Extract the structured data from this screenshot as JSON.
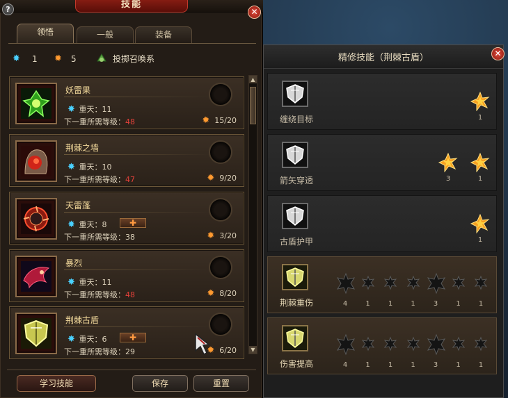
{
  "window": {
    "title": "技能",
    "help": "?",
    "close": "✕"
  },
  "tabs": [
    {
      "label": "领悟",
      "active": true
    },
    {
      "label": "一般",
      "active": false
    },
    {
      "label": "装备",
      "active": false
    }
  ],
  "stats": {
    "blue_points": "1",
    "orange_points": "5",
    "school": "投掷召唤系"
  },
  "skills": [
    {
      "name": "妖雷果",
      "level": "重天：11",
      "req_label": "下一重所需等级：",
      "req_value": "48",
      "req_met": false,
      "progress": "15/20",
      "has_plus": false,
      "icon": "thorn-fruit-icon",
      "color": "#2a7a18"
    },
    {
      "name": "荆棘之墙",
      "level": "重天：10",
      "req_label": "下一重所需等级：",
      "req_value": "47",
      "req_met": false,
      "progress": "9/20",
      "has_plus": false,
      "icon": "thorn-wall-icon",
      "color": "#c0241a"
    },
    {
      "name": "天雷蓬",
      "level": "重天：8",
      "req_label": "下一重所需等级：",
      "req_value": "38",
      "req_met": true,
      "progress": "3/20",
      "has_plus": true,
      "icon": "thunder-pod-icon",
      "color": "#d0301a"
    },
    {
      "name": "暴烈",
      "level": "重天：11",
      "req_label": "下一重所需等级：",
      "req_value": "48",
      "req_met": false,
      "progress": "8/20",
      "has_plus": false,
      "icon": "fury-icon",
      "color": "#b01a3a"
    },
    {
      "name": "荆棘古盾",
      "level": "重天：6",
      "req_label": "下一重所需等级：",
      "req_value": "29",
      "req_met": true,
      "progress": "6/20",
      "has_plus": true,
      "icon": "thorn-shield-icon",
      "color": "#c0c040"
    }
  ],
  "buttons": {
    "learn": "学习技能",
    "save": "保存",
    "reset": "重置"
  },
  "refine": {
    "title": "精修技能（荆棘古盾）",
    "close": "✕",
    "rows": [
      {
        "label": "缠绕目标",
        "style": "dark",
        "stars": [
          {
            "value": "1",
            "kind": "gold"
          }
        ]
      },
      {
        "label": "箭矢穿透",
        "style": "dark",
        "stars": [
          {
            "value": "3",
            "kind": "gold"
          },
          {
            "value": "1",
            "kind": "gold"
          }
        ]
      },
      {
        "label": "古盾护甲",
        "style": "dark",
        "stars": [
          {
            "value": "1",
            "kind": "gold"
          }
        ]
      },
      {
        "label": "荆棘重伤",
        "style": "brown",
        "stars": [
          {
            "value": "4",
            "kind": "big-dark"
          },
          {
            "value": "1",
            "kind": "dark"
          },
          {
            "value": "1",
            "kind": "dark"
          },
          {
            "value": "1",
            "kind": "dark"
          },
          {
            "value": "3",
            "kind": "big-dark"
          },
          {
            "value": "1",
            "kind": "dark"
          },
          {
            "value": "1",
            "kind": "dark"
          }
        ]
      },
      {
        "label": "伤害提高",
        "style": "brown",
        "stars": [
          {
            "value": "4",
            "kind": "big-dark"
          },
          {
            "value": "1",
            "kind": "dark"
          },
          {
            "value": "1",
            "kind": "dark"
          },
          {
            "value": "1",
            "kind": "dark"
          },
          {
            "value": "3",
            "kind": "big-dark"
          },
          {
            "value": "1",
            "kind": "dark"
          },
          {
            "value": "1",
            "kind": "dark"
          }
        ]
      }
    ]
  }
}
